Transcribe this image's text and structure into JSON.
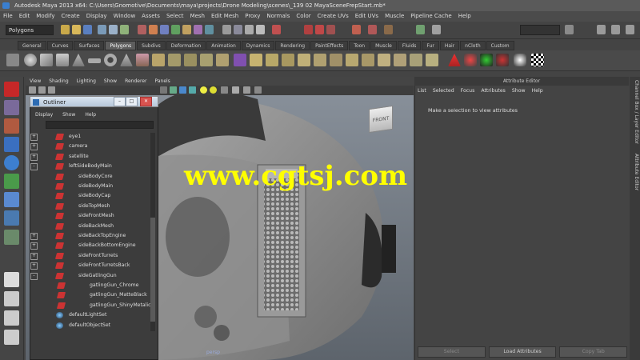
{
  "window": {
    "title": "Autodesk Maya 2013 x64: C:\\Users\\Gnomotive\\Documents\\maya\\projects\\Drone Modeling\\scenes\\_139 02 MayaSceneFrepStart.mb*"
  },
  "menubar": [
    "File",
    "Edit",
    "Modify",
    "Create",
    "Display",
    "Window",
    "Assets",
    "Select",
    "Mesh",
    "Edit Mesh",
    "Proxy",
    "Normals",
    "Color",
    "Create UVs",
    "Edit UVs",
    "Muscle",
    "Pipeline Cache",
    "Help"
  ],
  "statusline": {
    "mode": "Polygons"
  },
  "shelf": {
    "tabs": [
      "General",
      "Curves",
      "Surfaces",
      "Polygons",
      "Subdivs",
      "Deformation",
      "Animation",
      "Dynamics",
      "Rendering",
      "PaintEffects",
      "Toon",
      "Muscle",
      "Fluids",
      "Fur",
      "Hair",
      "nCloth",
      "Custom"
    ],
    "active_tab": "Polygons"
  },
  "viewport": {
    "menu": [
      "View",
      "Shading",
      "Lighting",
      "Show",
      "Renderer",
      "Panels"
    ],
    "viewcube_label": "FRONT",
    "camera_label": "persp"
  },
  "outliner": {
    "title": "Outliner",
    "menu": [
      "Display",
      "Show",
      "Help"
    ],
    "items": [
      {
        "label": "eye1",
        "indent": 0,
        "expander": "+",
        "icon": "mesh"
      },
      {
        "label": "camera",
        "indent": 0,
        "expander": "+",
        "icon": "mesh"
      },
      {
        "label": "satellite",
        "indent": 0,
        "expander": "+",
        "icon": "mesh"
      },
      {
        "label": "leftSideBodyMain",
        "indent": 0,
        "expander": "-",
        "icon": "mesh"
      },
      {
        "label": "sideBodyCore",
        "indent": 1,
        "expander": "",
        "icon": "mesh"
      },
      {
        "label": "sideBodyMain",
        "indent": 1,
        "expander": "",
        "icon": "mesh"
      },
      {
        "label": "sideBodyCap",
        "indent": 1,
        "expander": "",
        "icon": "mesh"
      },
      {
        "label": "sideTopMesh",
        "indent": 1,
        "expander": "",
        "icon": "mesh"
      },
      {
        "label": "sideFrontMesh",
        "indent": 1,
        "expander": "",
        "icon": "mesh"
      },
      {
        "label": "sideBackMesh",
        "indent": 1,
        "expander": "",
        "icon": "mesh"
      },
      {
        "label": "sideBackTopEngine",
        "indent": 1,
        "expander": "+",
        "icon": "mesh"
      },
      {
        "label": "sideBackBottomEngine",
        "indent": 1,
        "expander": "+",
        "icon": "mesh"
      },
      {
        "label": "sideFrontTurrets",
        "indent": 1,
        "expander": "+",
        "icon": "mesh"
      },
      {
        "label": "sideFrontTurretsBack",
        "indent": 1,
        "expander": "+",
        "icon": "mesh"
      },
      {
        "label": "sideGatlingGun",
        "indent": 1,
        "expander": "-",
        "icon": "mesh"
      },
      {
        "label": "gatlingGun_Chrome",
        "indent": 2,
        "expander": "",
        "icon": "mesh"
      },
      {
        "label": "gatlingGun_MatteBlack",
        "indent": 2,
        "expander": "",
        "icon": "mesh"
      },
      {
        "label": "gatlingGun_ShinyMetalic",
        "indent": 2,
        "expander": "",
        "icon": "mesh"
      },
      {
        "label": "defaultLightSet",
        "indent": 0,
        "expander": "",
        "icon": "set"
      },
      {
        "label": "defaultObjectSet",
        "indent": 0,
        "expander": "",
        "icon": "set"
      }
    ]
  },
  "attribute_editor": {
    "title": "Attribute Editor",
    "menu": [
      "List",
      "Selected",
      "Focus",
      "Attributes",
      "Show",
      "Help"
    ],
    "message": "Make a selection to view attributes",
    "buttons": [
      "Select",
      "Load Attributes",
      "Copy Tab"
    ],
    "side_tabs": [
      "Channel Box / Layer Editor",
      "Attribute Editor"
    ]
  },
  "watermark": "www.cgtsj.com"
}
